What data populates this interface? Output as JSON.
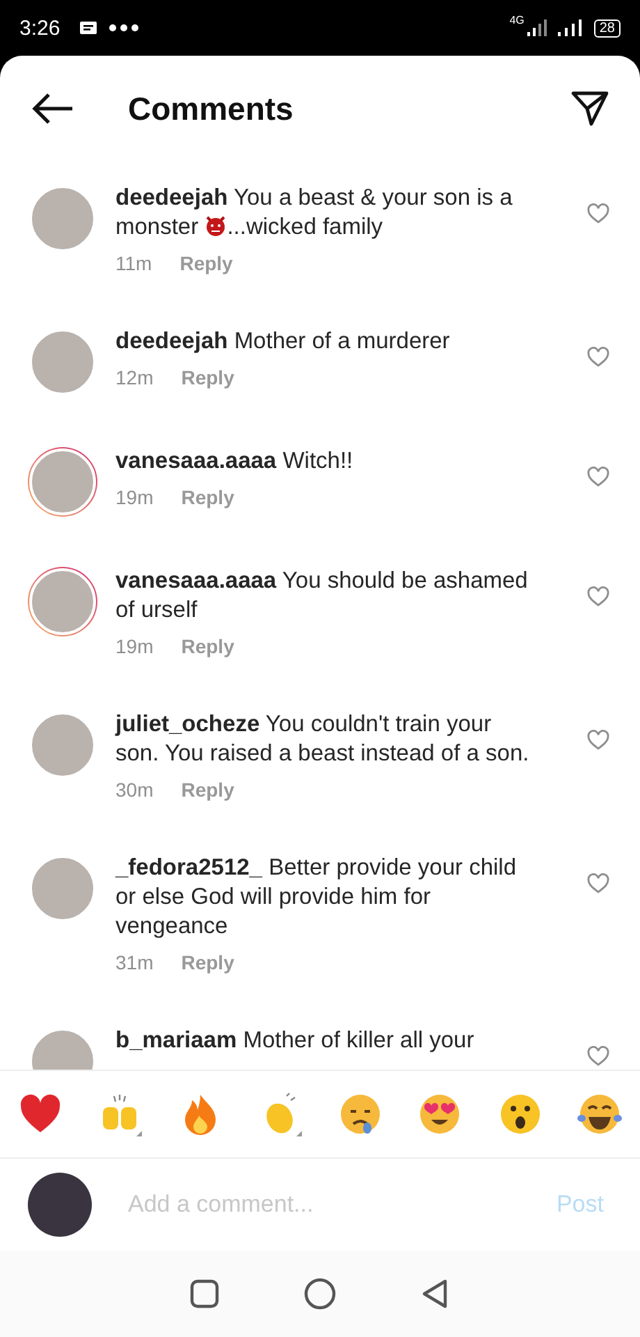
{
  "status_bar": {
    "time": "3:26",
    "network": "4G",
    "battery": "28"
  },
  "header": {
    "title": "Comments"
  },
  "comments": [
    {
      "username": "deedeejah",
      "has_story": false,
      "segments": [
        {
          "kind": "text",
          "text": "You a beast & your son is a monster "
        },
        {
          "kind": "devil-emoji"
        },
        {
          "kind": "text",
          "text": "...wicked family"
        }
      ],
      "time": "11m",
      "reply": "Reply",
      "liked": false
    },
    {
      "username": "deedeejah",
      "has_story": false,
      "segments": [
        {
          "kind": "text",
          "text": "Mother of a murderer"
        }
      ],
      "time": "12m",
      "reply": "Reply",
      "liked": false
    },
    {
      "username": "vanesaaa.aaaa",
      "has_story": true,
      "segments": [
        {
          "kind": "text",
          "text": "Witch!!"
        }
      ],
      "time": "19m",
      "reply": "Reply",
      "liked": false
    },
    {
      "username": "vanesaaa.aaaa",
      "has_story": true,
      "segments": [
        {
          "kind": "text",
          "text": "You should be ashamed of urself"
        }
      ],
      "time": "19m",
      "reply": "Reply",
      "liked": false
    },
    {
      "username": "juliet_ocheze",
      "has_story": false,
      "segments": [
        {
          "kind": "text",
          "text": "You couldn't train your son. You raised a beast instead of a son."
        }
      ],
      "time": "30m",
      "reply": "Reply",
      "liked": false
    },
    {
      "username": "_fedora2512_",
      "has_story": false,
      "segments": [
        {
          "kind": "text",
          "text": "Better provide your child or else God will provide him for vengeance"
        }
      ],
      "time": "31m",
      "reply": "Reply",
      "liked": false
    },
    {
      "username": "b_mariaam",
      "has_story": false,
      "segments": [
        {
          "kind": "text",
          "text": "Mother of killer all your"
        }
      ],
      "liked": false
    }
  ],
  "reactions": [
    {
      "kind": "heart",
      "has_variants": false
    },
    {
      "kind": "raised-hands",
      "has_variants": true
    },
    {
      "kind": "fire",
      "has_variants": false
    },
    {
      "kind": "clap",
      "has_variants": true
    },
    {
      "kind": "crying",
      "has_variants": false
    },
    {
      "kind": "heart-eyes",
      "has_variants": false
    },
    {
      "kind": "surprised",
      "has_variants": false
    },
    {
      "kind": "laughing",
      "has_variants": false
    }
  ],
  "composer": {
    "placeholder": "Add a comment...",
    "post": "Post"
  }
}
